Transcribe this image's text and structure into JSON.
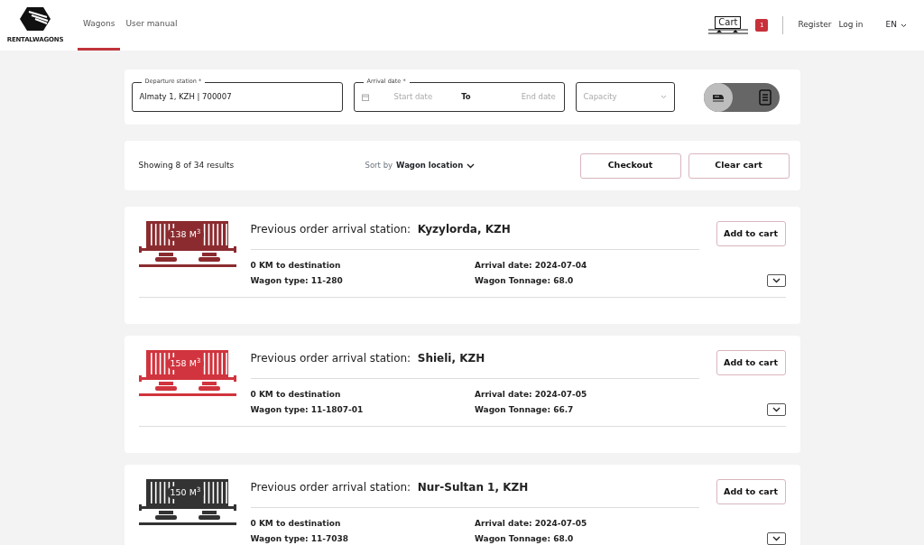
{
  "header": {
    "logo_text": "RENTALWAGONS",
    "tabs": [
      {
        "label": "Wagons",
        "selected": true
      },
      {
        "label": "User manual",
        "selected": false
      }
    ],
    "cart": {
      "label": "Cart",
      "count": "1"
    },
    "links": [
      "Register",
      "Log in"
    ],
    "language": "EN"
  },
  "filters": {
    "departure": {
      "label": "Departure station *",
      "value": "Almaty 1, KZH | 700007"
    },
    "arrival": {
      "label": "Arrival date *",
      "start_placeholder": "Start date",
      "separator": "To",
      "end_placeholder": "End date"
    },
    "capacity": {
      "placeholder": "Capacity"
    },
    "view_toggle": [
      {
        "kind": "train",
        "selected": true
      },
      {
        "kind": "list",
        "selected": false
      }
    ]
  },
  "results": {
    "summary": "Showing 8 of 34 results",
    "sort_label": "Sort by",
    "sort_value": "Wagon location",
    "buttons": [
      "Checkout",
      "Clear cart"
    ]
  },
  "wagons": [
    {
      "volume": "138 M$^{3}$",
      "color": "#8b2b2f",
      "station_label": "Previous order arrival station:",
      "station": "Kyzylorda, KZH",
      "distance": "0 KM to destination",
      "type": "Wagon type: 11-280",
      "arrival": "Arrival date: 2024-07-04",
      "tonnage": "Wagon Tonnage: 68.0",
      "button": "Add to cart"
    },
    {
      "volume": "158 M$^{3}$",
      "color": "#d1343e",
      "station_label": "Previous order arrival station:",
      "station": "Shieli, KZH",
      "distance": "0 KM to destination",
      "type": "Wagon type: 11-1807-01",
      "arrival": "Arrival date: 2024-07-05",
      "tonnage": "Wagon Tonnage: 66.7",
      "button": "Add to cart"
    },
    {
      "volume": "150 M$^{3}$",
      "color": "#333333",
      "station_label": "Previous order arrival station:",
      "station": "Nur-Sultan 1, KZH",
      "distance": "0 KM to destination",
      "type": "Wagon type: 11-7038",
      "arrival": "Arrival date: 2024-07-05",
      "tonnage": "Wagon Tonnage: 68.0",
      "button": "Add to cart"
    }
  ]
}
